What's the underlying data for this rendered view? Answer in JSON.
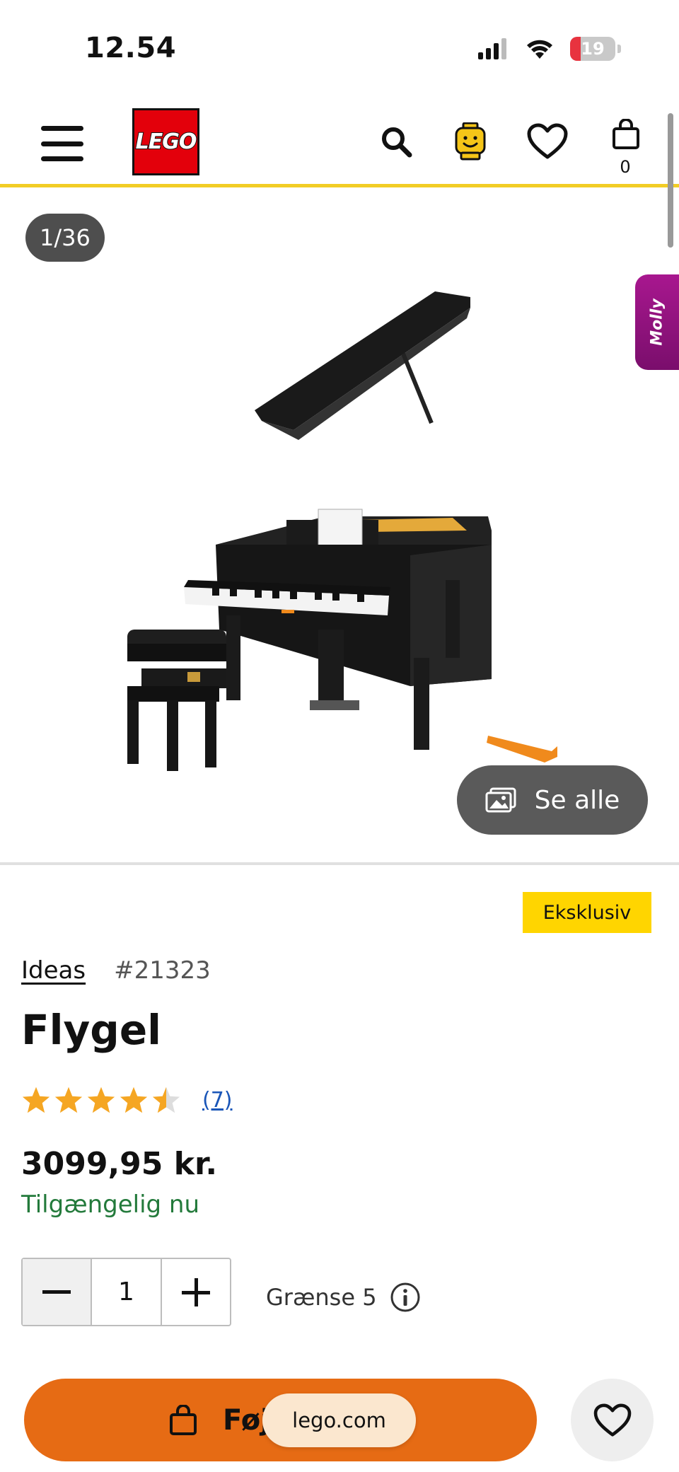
{
  "status_bar": {
    "time": "12.54",
    "battery": "19"
  },
  "header": {
    "logo_text": "LEGO",
    "cart_count": "0"
  },
  "gallery": {
    "counter": "1/36",
    "chat_widget": "Molly",
    "see_all_label": "Se alle"
  },
  "product": {
    "badge": "Eksklusiv",
    "theme": "Ideas",
    "item_number": "#21323",
    "title": "Flygel",
    "rating": {
      "value": 4.5,
      "max": 5,
      "review_count": "(7)"
    },
    "price": "3099,95 kr.",
    "availability": "Tilgængelig nu",
    "quantity": "1",
    "limit_label": "Grænse 5"
  },
  "bottom_bar": {
    "add_to_bag_label": "Føj til kurv",
    "url": "lego.com"
  },
  "colors": {
    "accent_yellow": "#f2cd25",
    "badge_yellow": "#ffd500",
    "cta_orange": "#e66b14",
    "star": "#f5a623",
    "available_green": "#237a3b",
    "link_blue": "#1a56b8"
  },
  "icons": [
    "signal-icon",
    "wifi-icon",
    "battery-icon",
    "menu-icon",
    "search-icon",
    "account-icon",
    "heart-icon",
    "bag-icon",
    "gallery-icon",
    "star-icon",
    "info-icon",
    "minus-icon",
    "plus-icon"
  ]
}
